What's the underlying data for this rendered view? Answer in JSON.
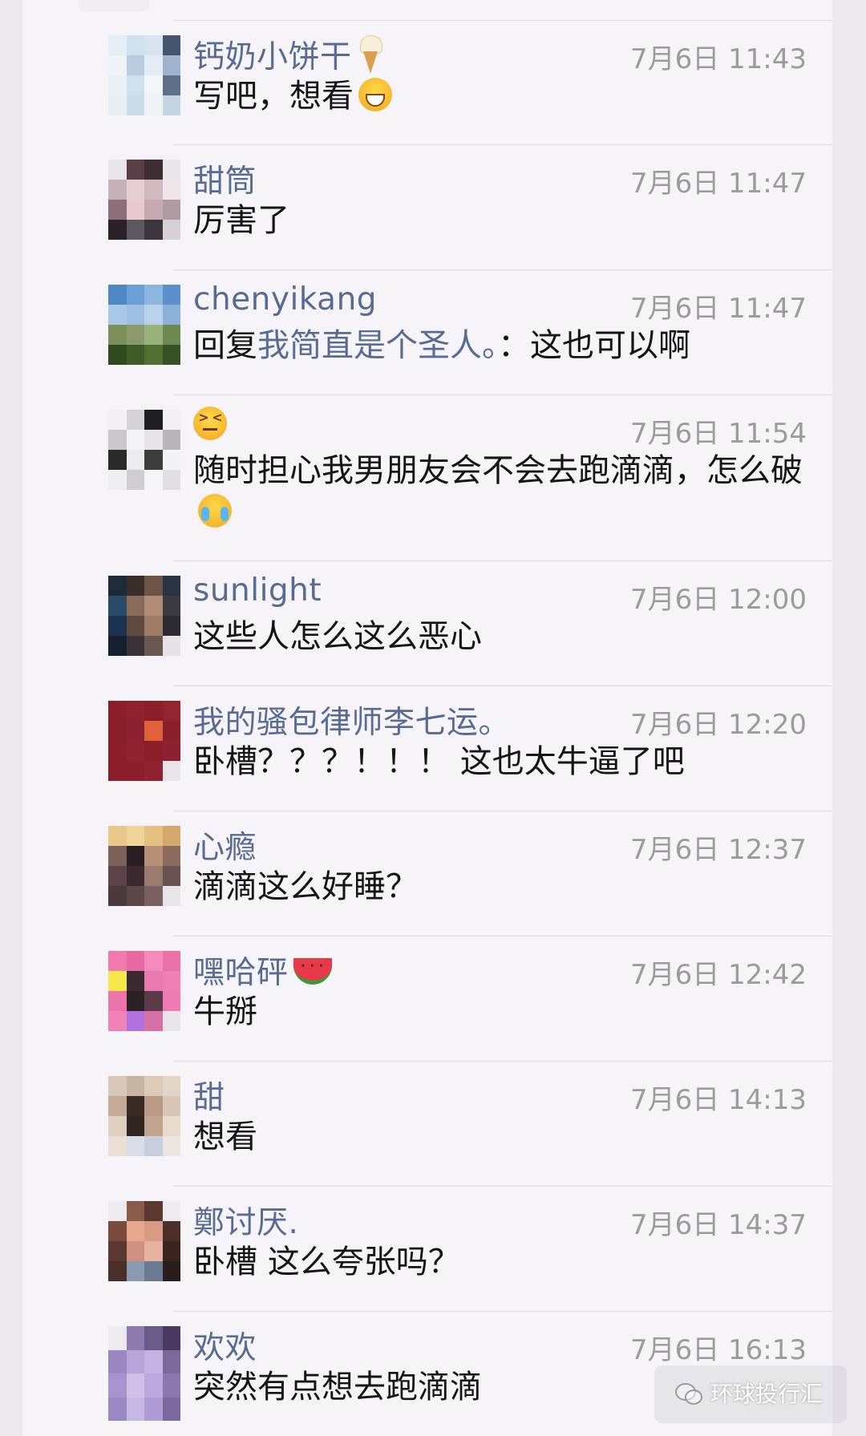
{
  "comments": [
    {
      "name": "钙奶小饼干",
      "name_emoji": "soft-ice-cream",
      "time": "7月6日 11:43",
      "text": "写吧，想看",
      "text_emoji": "grinning-face"
    },
    {
      "name": "甜筒",
      "time": "7月6日 11:47",
      "text": "厉害了"
    },
    {
      "name": "chenyikang",
      "time": "7月6日 11:47",
      "reply_prefix": "回复",
      "reply_name": "我简直是个圣人。",
      "reply_text": "：这也可以啊"
    },
    {
      "name_emoji": "confounded-face",
      "time": "7月6日 11:54",
      "text": "随时担心我男朋友会不会去跑滴滴，怎么破",
      "text_emoji": "face-with-tears"
    },
    {
      "name": "sunlight",
      "time": "7月6日 12:00",
      "text": "这些人怎么这么恶心"
    },
    {
      "name": "我的骚包律师李七运。",
      "time": "7月6日 12:20",
      "text": "卧槽？？？！！！ 这也太牛逼了吧"
    },
    {
      "name": "心瘾",
      "time": "7月6日 12:37",
      "text": "滴滴这么好睡？"
    },
    {
      "name": "嘿哈砰",
      "name_emoji": "watermelon",
      "time": "7月6日 12:42",
      "text": "牛掰"
    },
    {
      "name": "甜",
      "time": "7月6日 14:13",
      "text": "想看"
    },
    {
      "name": "鄭讨厌.",
      "time": "7月6日 14:37",
      "text": "卧槽 这么夸张吗？"
    },
    {
      "name": "欢欢",
      "time": "7月6日 16:13",
      "text": "突然有点想去跑滴滴"
    }
  ],
  "watermark": {
    "text": "环球投行汇",
    "icon": "wechat-icon"
  },
  "colors": {
    "name": "#586c93",
    "time": "#9b9a9f",
    "text": "#151515",
    "background": "#f6f4f8"
  }
}
